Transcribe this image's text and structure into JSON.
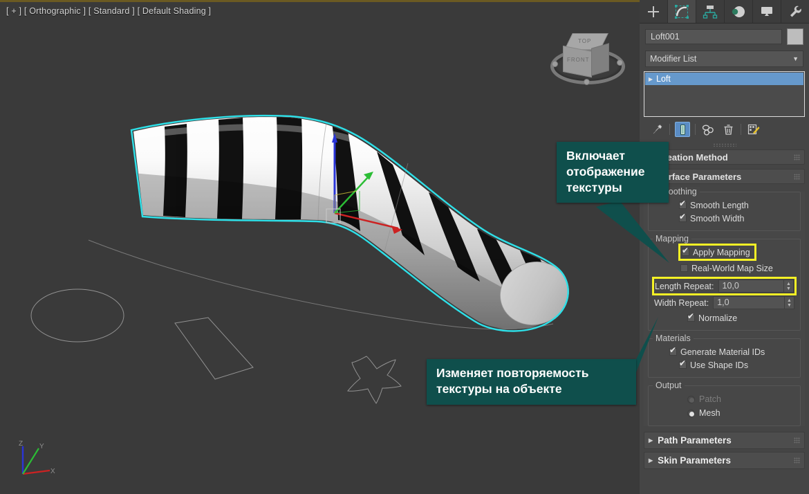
{
  "viewport": {
    "label": "[ + ] [ Orthographic ] [ Standard ] [ Default Shading ]",
    "background_color": "#3a3a3a",
    "selection_color": "#2ee0e8",
    "viewcube": {
      "top_face": "TOP",
      "front_face": "FRONT"
    },
    "shapes": [
      {
        "name": "ellipse-shape",
        "type": "ellipse"
      },
      {
        "name": "rectangle-shape",
        "type": "rectangle"
      },
      {
        "name": "star-shape",
        "type": "star"
      }
    ],
    "loft_object": {
      "name": "Loft001",
      "texture": "black-white-stripes",
      "stripes": 10
    }
  },
  "callouts": [
    {
      "id": "callout-apply-mapping",
      "lines": [
        "Включает",
        "отображение",
        "текстуры"
      ],
      "color": "#0f4f4c"
    },
    {
      "id": "callout-length-repeat",
      "lines": [
        "Изменяет повторяемость",
        "текстуры на объекте"
      ],
      "color": "#0f4f4c"
    }
  ],
  "panel": {
    "tabs": [
      {
        "name": "create",
        "icon": "plus-icon",
        "active": false
      },
      {
        "name": "modify",
        "icon": "modify-bend-icon",
        "active": true
      },
      {
        "name": "hierarchy",
        "icon": "hierarchy-icon",
        "active": false
      },
      {
        "name": "motion",
        "icon": "motion-wheel-icon",
        "active": false
      },
      {
        "name": "display",
        "icon": "display-monitor-icon",
        "active": false
      },
      {
        "name": "utilities",
        "icon": "wrench-icon",
        "active": false
      }
    ],
    "object_name": "Loft001",
    "object_color": "#bdbdbd",
    "modifier_list_label": "Modifier List",
    "stack": [
      {
        "label": "Loft",
        "selected": true
      }
    ],
    "stack_tools": [
      {
        "name": "pin-stack-icon",
        "active": false
      },
      {
        "name": "show-end-result-icon",
        "active": true
      },
      {
        "name": "make-unique-icon",
        "active": false
      },
      {
        "name": "remove-modifier-icon",
        "active": false
      },
      {
        "name": "configure-modifier-sets-icon",
        "active": false
      }
    ],
    "rollouts": [
      {
        "label": "Creation Method",
        "expanded": false
      },
      {
        "label": "Surface Parameters",
        "expanded": true
      }
    ],
    "surface_parameters": {
      "smoothing": {
        "label": "Smoothing",
        "options": [
          {
            "label": "Smooth Length",
            "checked": true
          },
          {
            "label": "Smooth Width",
            "checked": true
          }
        ]
      },
      "mapping": {
        "label": "Mapping",
        "apply_mapping": {
          "label": "Apply Mapping",
          "checked": true,
          "highlighted": true
        },
        "real_world_map_size": {
          "label": "Real-World Map Size",
          "checked": false
        },
        "length_repeat": {
          "label": "Length Repeat:",
          "value": "10,0",
          "highlighted": true
        },
        "width_repeat": {
          "label": "Width Repeat:",
          "value": "1,0",
          "highlighted": false
        },
        "normalize": {
          "label": "Normalize",
          "checked": true
        }
      },
      "materials": {
        "label": "Materials",
        "options": [
          {
            "label": "Generate Material IDs",
            "checked": true
          },
          {
            "label": "Use Shape IDs",
            "checked": true
          }
        ]
      },
      "output": {
        "label": "Output",
        "options": [
          {
            "label": "Patch",
            "selected": false,
            "disabled": true
          },
          {
            "label": "Mesh",
            "selected": true,
            "disabled": false
          }
        ]
      }
    },
    "bottom_rollouts": [
      {
        "label": "Path Parameters"
      },
      {
        "label": "Skin Parameters"
      }
    ]
  },
  "highlight_color": "#f5f125"
}
